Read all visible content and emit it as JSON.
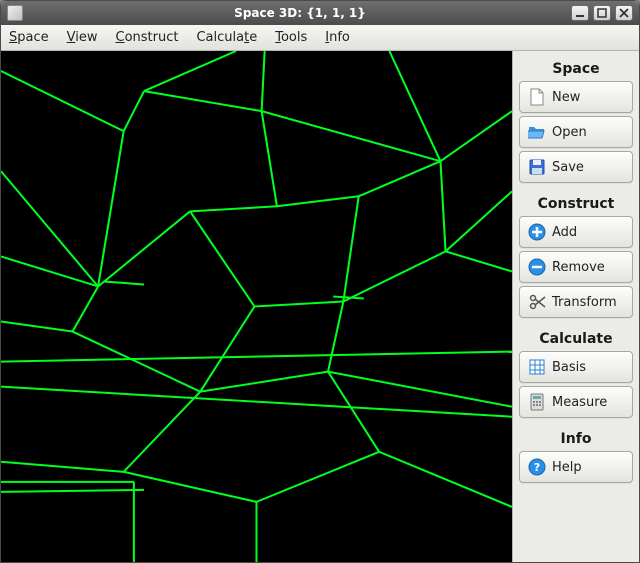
{
  "window": {
    "title": "Space 3D: {1, 1, 1}"
  },
  "menubar": {
    "items": [
      {
        "label": "Space",
        "ul": "S",
        "rest": "pace"
      },
      {
        "label": "View",
        "ul": "V",
        "rest": "iew"
      },
      {
        "label": "Construct",
        "ul": "C",
        "rest": "onstruct"
      },
      {
        "label": "Calculate",
        "ul": "",
        "rest": "Calcula",
        "ul2": "t",
        "rest2": "e"
      },
      {
        "label": "Tools",
        "ul": "T",
        "rest": "ools"
      },
      {
        "label": "Info",
        "ul": "I",
        "rest": "nfo"
      }
    ]
  },
  "sidebar": {
    "groups": [
      {
        "heading": "Space",
        "buttons": [
          {
            "label": "New",
            "icon": "file-icon"
          },
          {
            "label": "Open",
            "icon": "folder-open-icon"
          },
          {
            "label": "Save",
            "icon": "floppy-icon"
          }
        ]
      },
      {
        "heading": "Construct",
        "buttons": [
          {
            "label": "Add",
            "icon": "plus-circle-icon"
          },
          {
            "label": "Remove",
            "icon": "minus-circle-icon"
          },
          {
            "label": "Transform",
            "icon": "scissors-icon"
          }
        ]
      },
      {
        "heading": "Calculate",
        "buttons": [
          {
            "label": "Basis",
            "icon": "grid-icon"
          },
          {
            "label": "Measure",
            "icon": "calculator-icon"
          }
        ]
      },
      {
        "heading": "Info",
        "buttons": [
          {
            "label": "Help",
            "icon": "help-circle-icon"
          }
        ]
      }
    ]
  },
  "viewport": {
    "wire_color": "#00ff20",
    "bg_color": "#000000"
  }
}
